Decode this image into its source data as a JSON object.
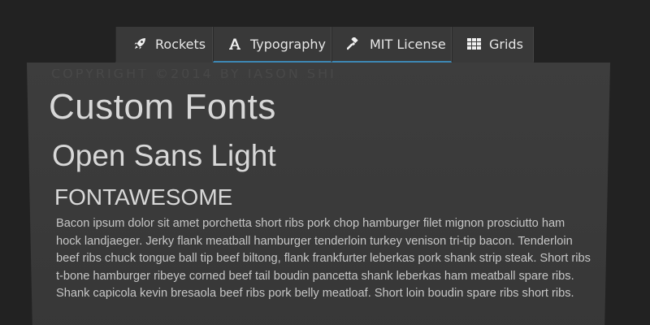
{
  "tabs": [
    {
      "label": "Rockets",
      "icon": "rocket-icon"
    },
    {
      "label": "Typography",
      "icon": "font-icon"
    },
    {
      "label": "MIT License",
      "icon": "gavel-icon"
    },
    {
      "label": "Grids",
      "icon": "grid-icon"
    }
  ],
  "panel": {
    "ghost_title": "COPYRIGHT ©2014 BY JASON SHI",
    "heading_1": "Custom Fonts",
    "heading_2": "Open Sans Light",
    "heading_3": "FONTAWESOME",
    "body": "Bacon ipsum dolor sit amet porchetta short ribs pork chop hamburger filet mignon prosciutto ham hock landjaeger. Jerky flank meatball hamburger tenderloin turkey venison tri-tip bacon. Tenderloin beef ribs chuck tongue ball tip beef biltong, flank frankfurter leberkas pork shank strip steak. Short ribs t-bone hamburger ribeye corned beef tail boudin pancetta shank leberkas ham meatball spare ribs. Shank capicola kevin bresaola beef ribs pork belly meatloaf. Short loin boudin spare ribs short ribs."
  },
  "colors": {
    "background": "#222222",
    "tab_background": "#393939",
    "active_tab_underline": "#3d88b5",
    "panel_background": "#3a3a3a",
    "text": "#d8d8d8"
  }
}
